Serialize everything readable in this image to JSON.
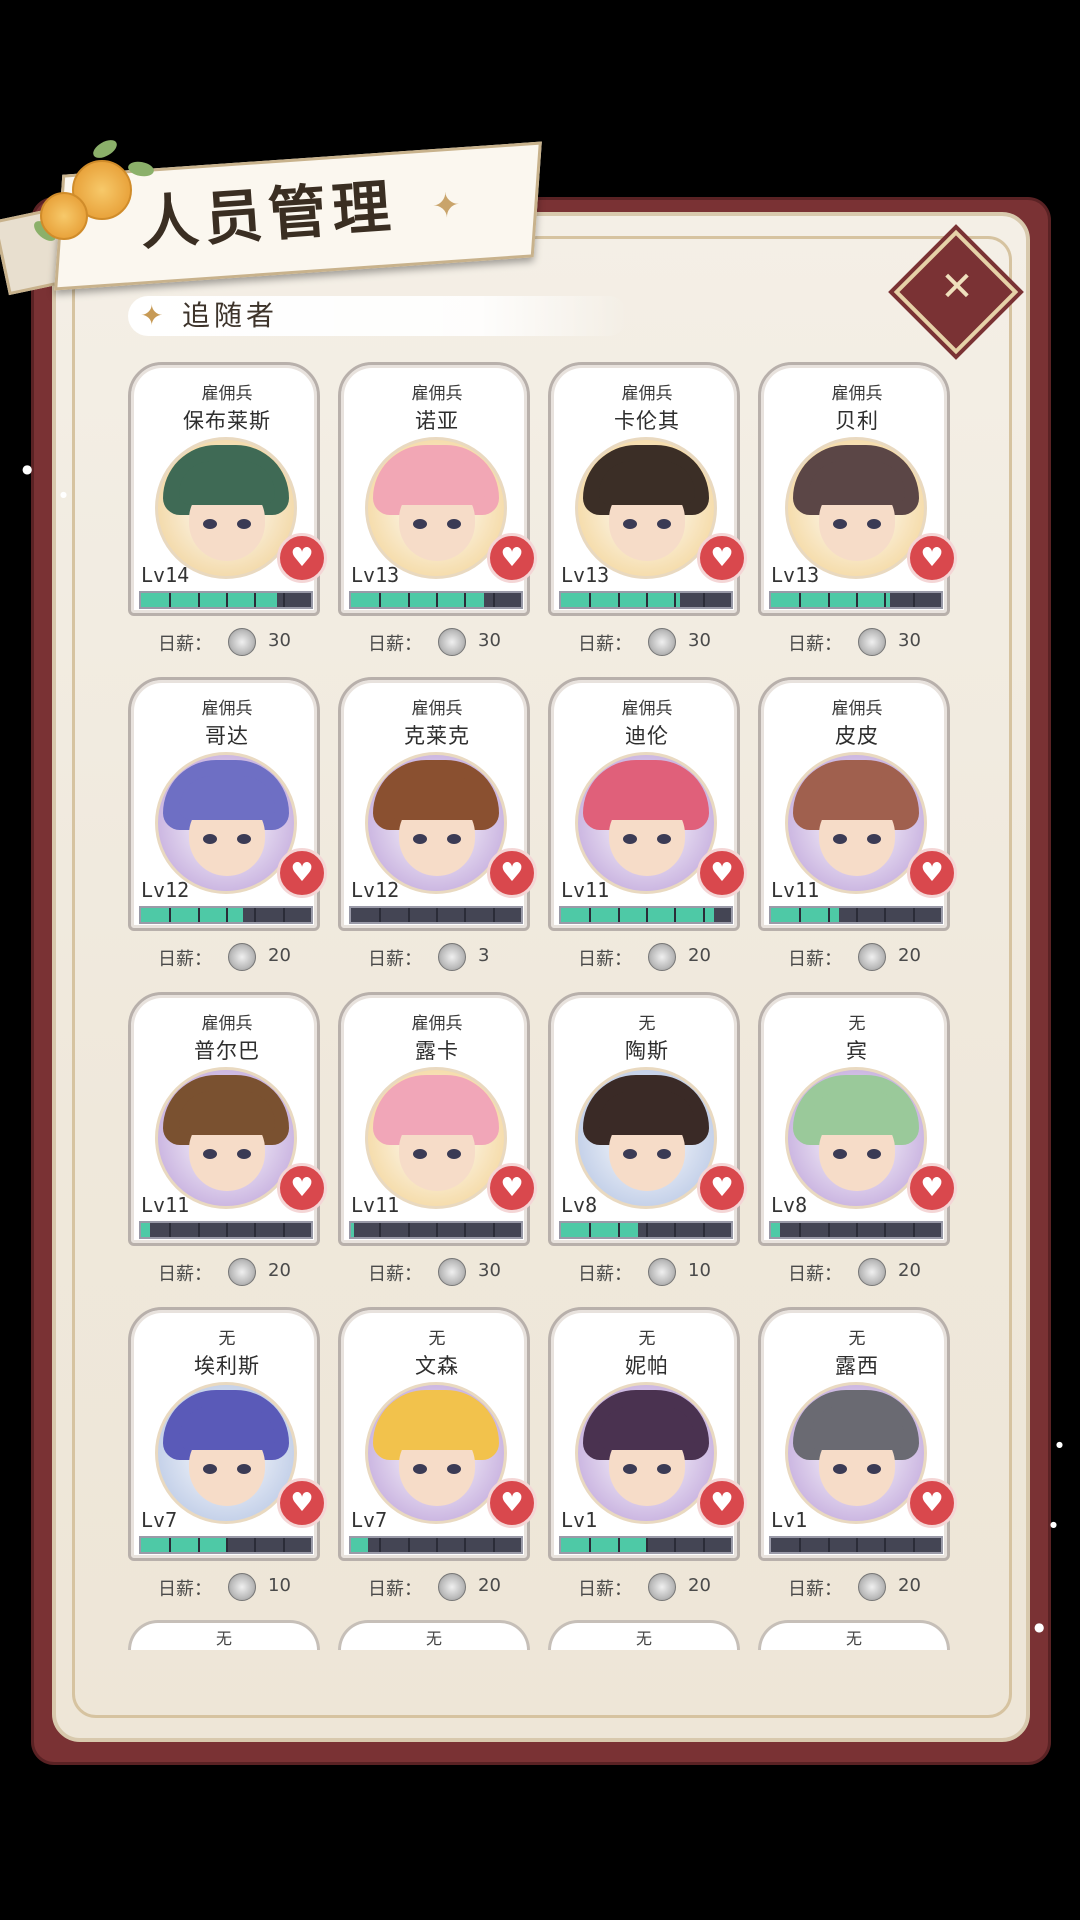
{
  "header": {
    "title": "人员管理",
    "section": "追随者"
  },
  "wage_label": "日薪：",
  "followers": [
    {
      "role": "雇佣兵",
      "name": "保布莱斯",
      "level": "Lv14",
      "exp": 0.8,
      "wage": "30",
      "hair": "#3f6a55",
      "bg": "#f3d9a8"
    },
    {
      "role": "雇佣兵",
      "name": "诺亚",
      "level": "Lv13",
      "exp": 0.78,
      "wage": "30",
      "hair": "#f2a7b5",
      "bg": "#f5dba8"
    },
    {
      "role": "雇佣兵",
      "name": "卡伦其",
      "level": "Lv13",
      "exp": 0.7,
      "wage": "30",
      "hair": "#3b2e26",
      "bg": "#f5dba8"
    },
    {
      "role": "雇佣兵",
      "name": "贝利",
      "level": "Lv13",
      "exp": 0.7,
      "wage": "30",
      "hair": "#5b4646",
      "bg": "#f5dba8"
    },
    {
      "role": "雇佣兵",
      "name": "哥达",
      "level": "Lv12",
      "exp": 0.6,
      "wage": "20",
      "hair": "#6e6fc4",
      "bg": "#c9b3e0"
    },
    {
      "role": "雇佣兵",
      "name": "克莱克",
      "level": "Lv12",
      "exp": 0.0,
      "wage": "3",
      "hair": "#8a5030",
      "bg": "#c9b3e0"
    },
    {
      "role": "雇佣兵",
      "name": "迪伦",
      "level": "Lv11",
      "exp": 0.9,
      "wage": "20",
      "hair": "#e0607a",
      "bg": "#c9b3e0"
    },
    {
      "role": "雇佣兵",
      "name": "皮皮",
      "level": "Lv11",
      "exp": 0.4,
      "wage": "20",
      "hair": "#a0604e",
      "bg": "#c9b3e0"
    },
    {
      "role": "雇佣兵",
      "name": "普尔巴",
      "level": "Lv11",
      "exp": 0.05,
      "wage": "20",
      "hair": "#7a5130",
      "bg": "#c9b3e0"
    },
    {
      "role": "雇佣兵",
      "name": "露卡",
      "level": "Lv11",
      "exp": 0.02,
      "wage": "30",
      "hair": "#f1a6b8",
      "bg": "#f5dba8"
    },
    {
      "role": "无",
      "name": "陶斯",
      "level": "Lv8",
      "exp": 0.45,
      "wage": "10",
      "hair": "#3a2a26",
      "bg": "#c2cfe8"
    },
    {
      "role": "无",
      "name": "宾",
      "level": "Lv8",
      "exp": 0.05,
      "wage": "20",
      "hair": "#9ac99a",
      "bg": "#c9b3e0"
    },
    {
      "role": "无",
      "name": "埃利斯",
      "level": "Lv7",
      "exp": 0.5,
      "wage": "10",
      "hair": "#5a5ab8",
      "bg": "#c2cfe8"
    },
    {
      "role": "无",
      "name": "文森",
      "level": "Lv7",
      "exp": 0.1,
      "wage": "20",
      "hair": "#f2c24c",
      "bg": "#c9b3e0"
    },
    {
      "role": "无",
      "name": "妮帕",
      "level": "Lv1",
      "exp": 0.5,
      "wage": "20",
      "hair": "#4a3250",
      "bg": "#c9b3e0"
    },
    {
      "role": "无",
      "name": "露西",
      "level": "Lv1",
      "exp": 0.0,
      "wage": "20",
      "hair": "#6a6a72",
      "bg": "#c9b3e0"
    }
  ],
  "next_row_roles": [
    "无",
    "无",
    "无",
    "无"
  ],
  "colors": {
    "frame": "#7a3234",
    "exp_fill": "#4ec9a6",
    "heart": "#d9484d"
  },
  "icons": {
    "close": "close-icon",
    "heart": "heart-icon",
    "coin": "silver-coin-icon",
    "star": "star-icon"
  }
}
